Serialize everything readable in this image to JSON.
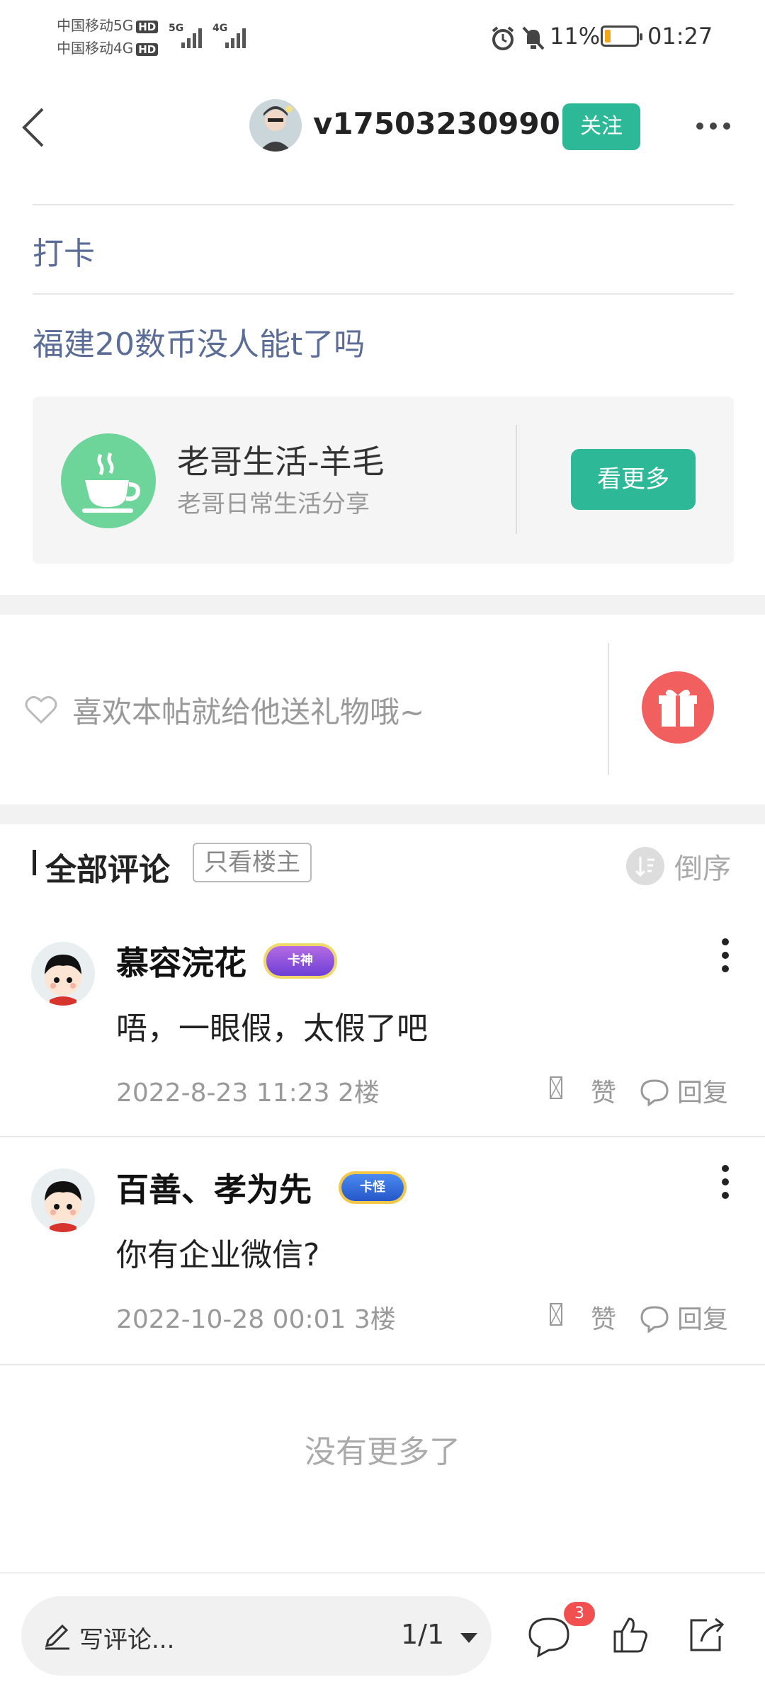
{
  "status_bar": {
    "carrier1": "中国移动5G",
    "carrier2": "中国移动4G",
    "hd": "HD",
    "net1": "5G",
    "net2": "4G",
    "battery": "11%",
    "time": "01:27"
  },
  "header": {
    "username": "v17503230990",
    "follow_label": "关注"
  },
  "post": {
    "tag": "打卡",
    "title": "福建20数币没人能t了吗"
  },
  "circle_card": {
    "name": "老哥生活-羊毛",
    "description": "老哥日常生活分享",
    "more_label": "看更多"
  },
  "gift": {
    "prompt": "喜欢本帖就给他送礼物哦~"
  },
  "comments_section": {
    "title": "全部评论",
    "filter_label": "只看楼主",
    "sort_label": "倒序"
  },
  "comments": [
    {
      "name": "慕容浣花",
      "badge": "卡神",
      "text": "唔，一眼假，太假了吧",
      "meta": "2022-8-23 11:23  2楼",
      "like": "赞",
      "reply": "回复"
    },
    {
      "name": "百善、孝为先",
      "badge": "卡怪",
      "text": "你有企业微信?",
      "meta": "2022-10-28 00:01  3楼",
      "like": "赞",
      "reply": "回复"
    }
  ],
  "end_text": "没有更多了",
  "bottom_bar": {
    "comment_placeholder": "写评论...",
    "page": "1/1",
    "comment_count": "3"
  },
  "colors": {
    "accent": "#2db897",
    "link": "#5b6d96",
    "gift": "#f25f5f",
    "badge_red": "#f25050"
  }
}
